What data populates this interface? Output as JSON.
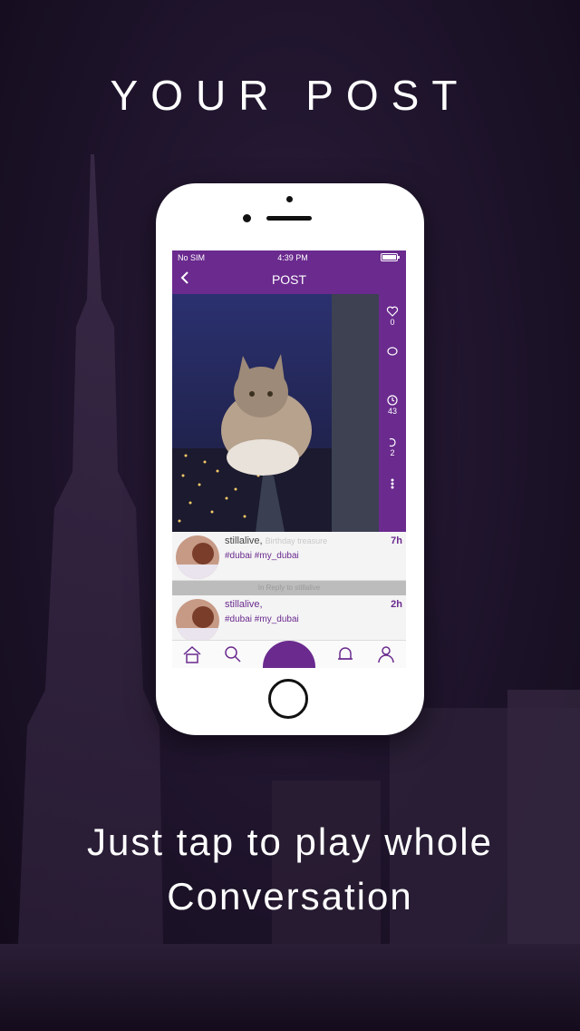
{
  "headline": "YOUR POST",
  "tagline_line1": "Just tap to play whole",
  "tagline_line2": "Conversation",
  "colors": {
    "accent": "#6a2a8e",
    "background": "#1c1228"
  },
  "statusbar": {
    "carrier": "No SIM",
    "time": "4:39 PM"
  },
  "navbar": {
    "back_icon": "chevron-left-icon",
    "title": "POST"
  },
  "side_rail": [
    {
      "icon": "heart-icon",
      "count": "0"
    },
    {
      "icon": "comment-icon",
      "count": ""
    },
    {
      "icon": "history-icon",
      "count": "43"
    },
    {
      "icon": "reply-icon",
      "count": "2"
    },
    {
      "icon": "more-icon",
      "count": ""
    }
  ],
  "comments": [
    {
      "user": "stillalive,",
      "subtitle": "Birthday treasure",
      "tags": "#dubai #my_dubai",
      "time": "7h"
    },
    {
      "user": "stillalive,",
      "subtitle": "",
      "tags": "#dubai #my_dubai",
      "time": "2h"
    }
  ],
  "reply_bar": "In Reply to stillalive",
  "tabs": [
    {
      "icon": "home-icon"
    },
    {
      "icon": "search-icon"
    },
    {
      "icon": "record-icon"
    },
    {
      "icon": "bell-icon"
    },
    {
      "icon": "profile-icon"
    }
  ]
}
